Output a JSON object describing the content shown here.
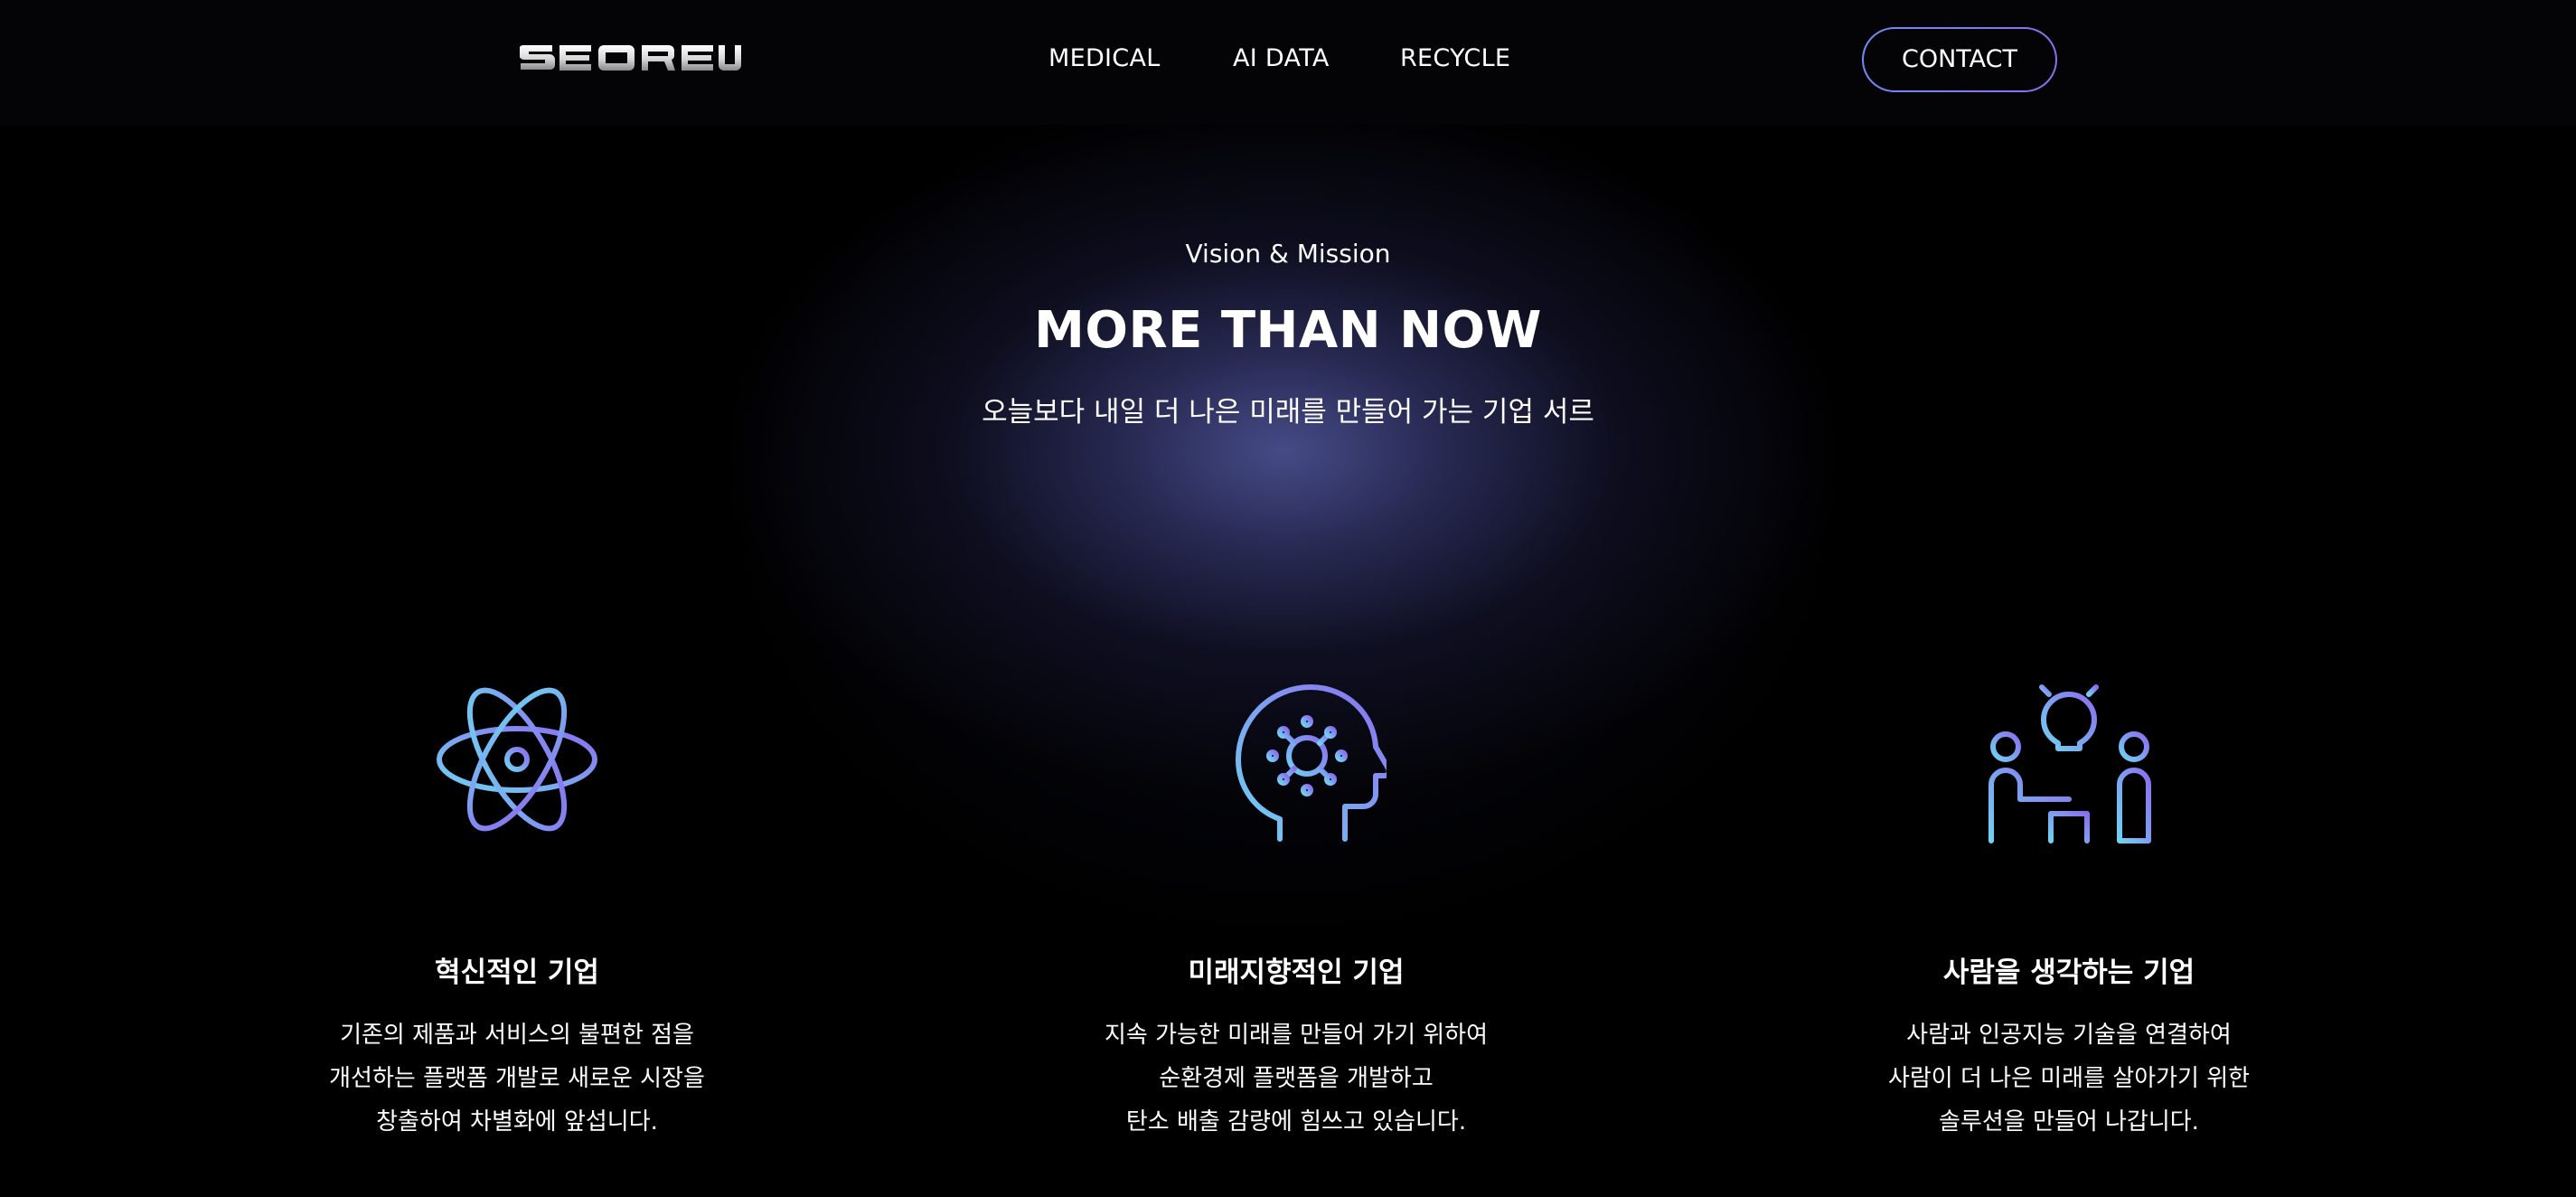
{
  "nav": {
    "items": [
      "MEDICAL",
      "AI DATA",
      "RECYCLE"
    ],
    "contact_label": "CONTACT"
  },
  "hero": {
    "eyebrow": "Vision & Mission",
    "title": "MORE THAN NOW",
    "subtitle": "오늘보다 내일 더 나은 미래를 만들어 가는 기업 서르"
  },
  "values": [
    {
      "icon": "atom-icon",
      "title": "혁신적인 기업",
      "lines": [
        "기존의 제품과 서비스의 불편한 점을",
        "개선하는 플랫폼 개발로 새로운 시장을",
        "창출하여 차별화에 앞섭니다."
      ]
    },
    {
      "icon": "head-circuit-icon",
      "title": "미래지향적인 기업",
      "lines": [
        "지속 가능한 미래를 만들어 가기 위하여",
        "순환경제 플랫폼을 개발하고",
        "탄소 배출 감량에 힘쓰고 있습니다."
      ]
    },
    {
      "icon": "people-idea-icon",
      "title": "사람을 생각하는 기업",
      "lines": [
        "사람과 인공지능 기술을 연결하여",
        "사람이 더 나은 미래를 살아가기 위한",
        "솔루션을 만들어 나갑니다."
      ]
    }
  ],
  "colors": {
    "background": "#000000",
    "accent_gradient_start": "#6fb8f2",
    "accent_gradient_end": "#8b6ef0",
    "glow": "#484e8c"
  }
}
